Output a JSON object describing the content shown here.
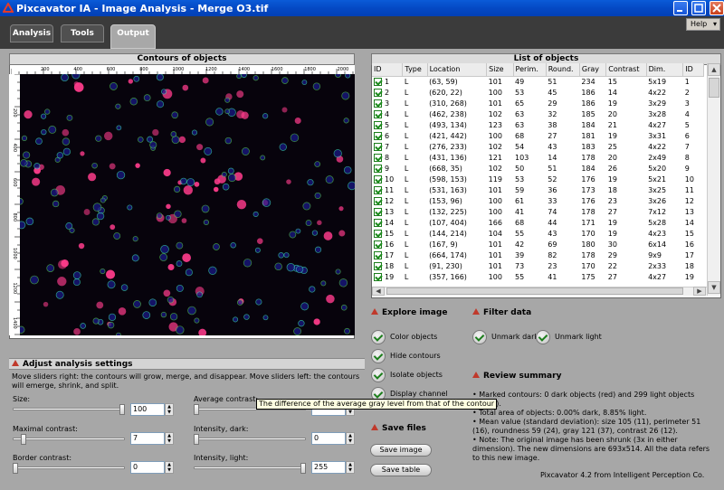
{
  "window": {
    "title": "Pixcavator IA - Image Analysis - Merge O3.tif"
  },
  "tabs": [
    "Analysis",
    "Tools",
    "Output"
  ],
  "active_tab": "Output",
  "help_label": "Help",
  "contours_panel": {
    "title": "Contours of objects",
    "ruler_top": [
      "200",
      "400",
      "600",
      "800",
      "1000",
      "1200",
      "1400",
      "1600",
      "1800",
      "2000"
    ],
    "ruler_left": [
      "200",
      "400",
      "600",
      "800",
      "1000",
      "1200",
      "1400"
    ]
  },
  "list_panel": {
    "title": "List of objects",
    "columns": [
      "ID",
      "Type",
      "Location",
      "Size",
      "Perim.",
      "Round.",
      "Gray",
      "Contrast",
      "Dim.",
      "ID"
    ],
    "rows": [
      [
        "1",
        "L",
        "(63, 59)",
        "101",
        "49",
        "51",
        "234",
        "15",
        "5x19",
        "1"
      ],
      [
        "2",
        "L",
        "(620, 22)",
        "100",
        "53",
        "45",
        "186",
        "14",
        "4x22",
        "2"
      ],
      [
        "3",
        "L",
        "(310, 268)",
        "101",
        "65",
        "29",
        "186",
        "19",
        "3x29",
        "3"
      ],
      [
        "4",
        "L",
        "(462, 238)",
        "102",
        "63",
        "32",
        "185",
        "20",
        "3x28",
        "4"
      ],
      [
        "5",
        "L",
        "(493, 134)",
        "123",
        "63",
        "38",
        "184",
        "21",
        "4x27",
        "5"
      ],
      [
        "6",
        "L",
        "(421, 442)",
        "100",
        "68",
        "27",
        "181",
        "19",
        "3x31",
        "6"
      ],
      [
        "7",
        "L",
        "(276, 233)",
        "102",
        "54",
        "43",
        "183",
        "25",
        "4x22",
        "7"
      ],
      [
        "8",
        "L",
        "(431, 136)",
        "121",
        "103",
        "14",
        "178",
        "20",
        "2x49",
        "8"
      ],
      [
        "9",
        "L",
        "(668, 35)",
        "102",
        "50",
        "51",
        "184",
        "26",
        "5x20",
        "9"
      ],
      [
        "10",
        "L",
        "(598, 153)",
        "119",
        "53",
        "52",
        "176",
        "19",
        "5x21",
        "10"
      ],
      [
        "11",
        "L",
        "(531, 163)",
        "101",
        "59",
        "36",
        "173",
        "18",
        "3x25",
        "11"
      ],
      [
        "12",
        "L",
        "(153, 96)",
        "100",
        "61",
        "33",
        "176",
        "23",
        "3x26",
        "12"
      ],
      [
        "13",
        "L",
        "(132, 225)",
        "100",
        "41",
        "74",
        "178",
        "27",
        "7x12",
        "13"
      ],
      [
        "14",
        "L",
        "(107, 404)",
        "166",
        "68",
        "44",
        "171",
        "19",
        "5x28",
        "14"
      ],
      [
        "15",
        "L",
        "(144, 214)",
        "104",
        "55",
        "43",
        "170",
        "19",
        "4x23",
        "15"
      ],
      [
        "16",
        "L",
        "(167, 9)",
        "101",
        "42",
        "69",
        "180",
        "30",
        "6x14",
        "16"
      ],
      [
        "17",
        "L",
        "(664, 174)",
        "101",
        "39",
        "82",
        "178",
        "29",
        "9x9",
        "17"
      ],
      [
        "18",
        "L",
        "(91, 230)",
        "101",
        "73",
        "23",
        "170",
        "22",
        "2x33",
        "18"
      ],
      [
        "19",
        "L",
        "(357, 166)",
        "100",
        "55",
        "41",
        "175",
        "27",
        "4x27",
        "19"
      ]
    ]
  },
  "explore": {
    "title": "Explore image",
    "options": [
      "Color objects",
      "Hide contours",
      "Isolate objects",
      "Display channel"
    ]
  },
  "filter": {
    "title": "Filter data",
    "options": [
      "Unmark dark",
      "Unmark light"
    ]
  },
  "files": {
    "title": "Save files",
    "buttons": [
      "Save image",
      "Save table"
    ]
  },
  "review": {
    "title": "Review summary",
    "lines": [
      "• Marked contours: 0 dark objects (red) and 299 light objects (green).",
      "• Total area of objects: 0.00% dark, 8.85% light.",
      "• Mean value (standard deviation): size 105 (11), perimeter 51 (16), roundness 59 (24), gray 121 (37), contrast 26 (12).",
      "• Note: The original image has been shrunk (3x in either dimension). The new dimensions are 693x514. All the data refers to this new image."
    ]
  },
  "footer": "Pixcavator 4.2 from Intelligent Perception Co.",
  "adjust": {
    "title": "Adjust analysis settings",
    "description": "Move sliders right: the contours will grow, merge, and disappear. Move sliders left: the contours will emerge, shrink, and split.",
    "sliders": [
      {
        "label": "Size:",
        "value": "100",
        "level": 1.0
      },
      {
        "label": "Maximal contrast:",
        "value": "7",
        "level": 0.08
      },
      {
        "label": "Border contrast:",
        "value": "0",
        "level": 0.0
      },
      {
        "label": "Average contrast:",
        "value": "",
        "level": 0.0
      },
      {
        "label": "Intensity, dark:",
        "value": "0",
        "level": 0.0
      },
      {
        "label": "Intensity, light:",
        "value": "255",
        "level": 1.0
      }
    ]
  },
  "tooltip": "The difference of the average gray level from that of the contour",
  "colors": {
    "accent_green": "#1b8a1b",
    "review_red": "#c0392b",
    "title_blue": "#0449c4"
  }
}
